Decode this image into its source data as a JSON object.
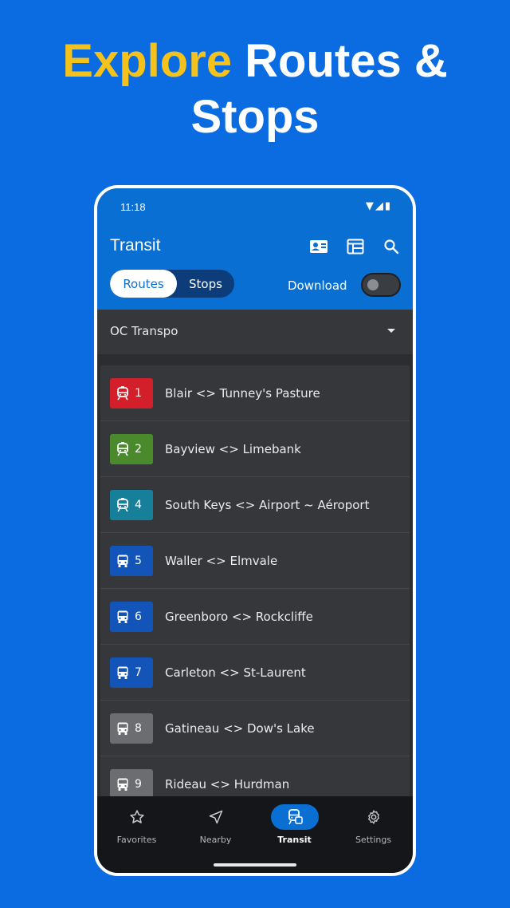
{
  "headline": {
    "accent": "Explore",
    "rest_line1": " Routes &",
    "line2": "Stops"
  },
  "status_bar": {
    "time": "11:18"
  },
  "app_bar": {
    "title": "Transit"
  },
  "segmented": {
    "routes_label": "Routes",
    "stops_label": "Stops"
  },
  "download": {
    "label": "Download",
    "enabled": false
  },
  "agency": {
    "selected": "OC Transpo"
  },
  "routes": [
    {
      "number": "1",
      "name": "Blair <> Tunney's Pasture",
      "color": "#d21f2a",
      "vehicle": "train-icon"
    },
    {
      "number": "2",
      "name": "Bayview <> Limebank",
      "color": "#4b8a2c",
      "vehicle": "train-icon"
    },
    {
      "number": "4",
      "name": "South Keys <> Airport ~ Aéroport",
      "color": "#167f99",
      "vehicle": "train-icon"
    },
    {
      "number": "5",
      "name": "Waller <> Elmvale",
      "color": "#1254b8",
      "vehicle": "bus-icon"
    },
    {
      "number": "6",
      "name": "Greenboro <> Rockcliffe",
      "color": "#1254b8",
      "vehicle": "bus-icon"
    },
    {
      "number": "7",
      "name": "Carleton <> St-Laurent",
      "color": "#1254b8",
      "vehicle": "bus-icon"
    },
    {
      "number": "8",
      "name": "Gatineau <> Dow's Lake",
      "color": "#6b6d70",
      "vehicle": "bus-icon"
    },
    {
      "number": "9",
      "name": "Rideau <> Hurdman",
      "color": "#6b6d70",
      "vehicle": "bus-icon"
    }
  ],
  "bottom_nav": {
    "items": [
      {
        "label": "Favorites",
        "icon": "star-icon",
        "active": false
      },
      {
        "label": "Nearby",
        "icon": "navigation-arrow-icon",
        "active": false
      },
      {
        "label": "Transit",
        "icon": "transit-icon",
        "active": true
      },
      {
        "label": "Settings",
        "icon": "gear-icon",
        "active": false
      }
    ]
  },
  "colors": {
    "background": "#0a6ce0",
    "accent": "#f5c21b",
    "app_bar": "#0a6fd3"
  }
}
